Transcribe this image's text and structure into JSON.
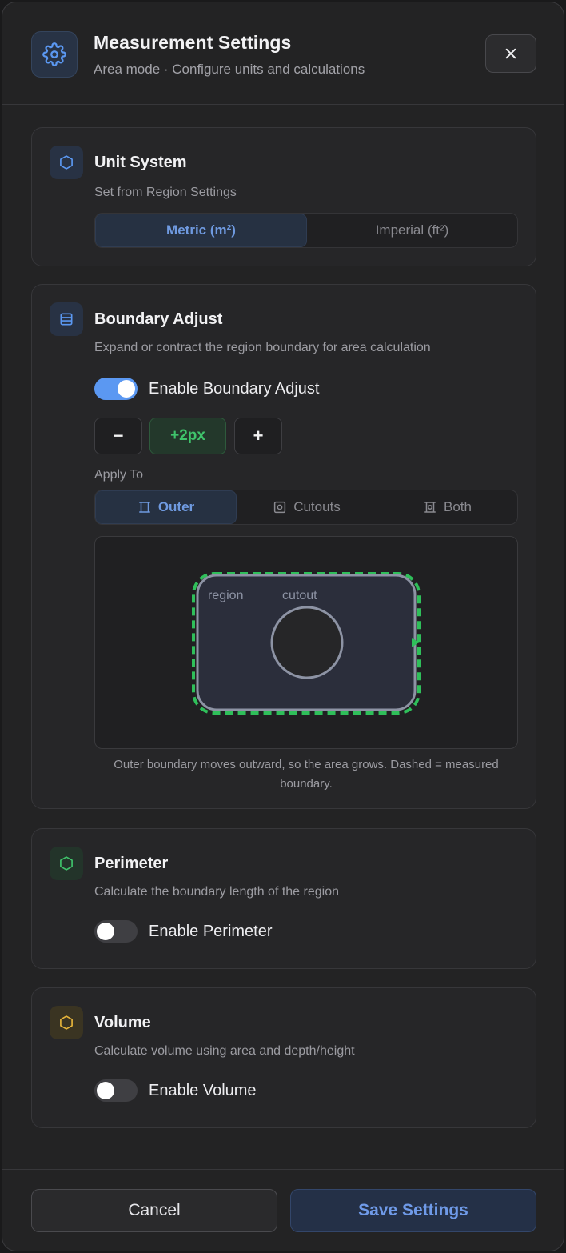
{
  "header": {
    "title": "Measurement Settings",
    "subtitle": "Area mode · Configure units and calculations",
    "icon": "gear-icon",
    "close_icon": "close-icon"
  },
  "unit_system": {
    "title": "Unit System",
    "description": "Set from Region Settings",
    "options": [
      "Metric (m²)",
      "Imperial (ft²)"
    ],
    "selected": "Metric (m²)"
  },
  "boundary_adjust": {
    "title": "Boundary Adjust",
    "description": "Expand or contract the region boundary for area calculation",
    "toggle_label": "Enable Boundary Adjust",
    "enabled": true,
    "decrement_label": "−",
    "value": "+2px",
    "increment_label": "+",
    "apply_label": "Apply To",
    "apply_options": [
      "Outer",
      "Cutouts",
      "Both"
    ],
    "apply_selected": "Outer",
    "diagram": {
      "region_label": "region",
      "cutout_label": "cutout"
    },
    "caption": "Outer boundary moves outward, so the area grows. Dashed = measured boundary."
  },
  "perimeter": {
    "title": "Perimeter",
    "description": "Calculate the boundary length of the region",
    "toggle_label": "Enable Perimeter",
    "enabled": false
  },
  "volume": {
    "title": "Volume",
    "description": "Calculate volume using area and depth/height",
    "toggle_label": "Enable Volume",
    "enabled": false
  },
  "footer": {
    "cancel_label": "Cancel",
    "save_label": "Save Settings"
  },
  "colors": {
    "accent": "#5b98f2",
    "green": "#3fc36b",
    "yellow": "#e6b43a"
  }
}
